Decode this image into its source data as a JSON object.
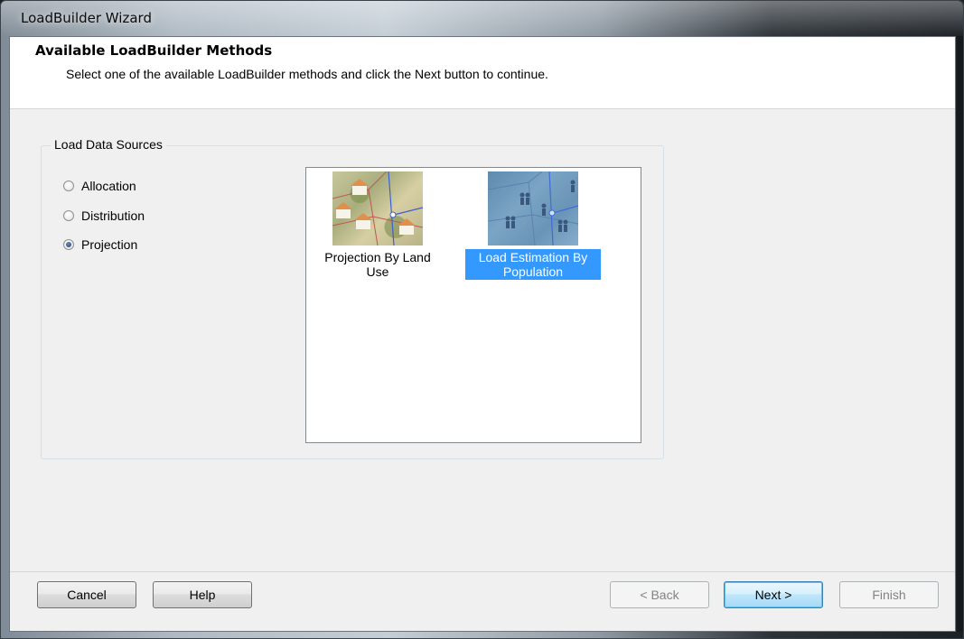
{
  "window": {
    "title": "LoadBuilder Wizard"
  },
  "header": {
    "title": "Available LoadBuilder Methods",
    "subtitle": "Select one of the available LoadBuilder methods and click the Next button to continue."
  },
  "group": {
    "legend": "Load Data Sources",
    "options": [
      {
        "label": "Allocation",
        "checked": false
      },
      {
        "label": "Distribution",
        "checked": false
      },
      {
        "label": "Projection",
        "checked": true
      }
    ]
  },
  "methods": {
    "items": [
      {
        "label": "Projection By Land Use",
        "icon": "land-use-icon",
        "selected": false
      },
      {
        "label": "Load Estimation By Population",
        "icon": "population-icon",
        "selected": true
      }
    ]
  },
  "buttons": {
    "cancel": "Cancel",
    "help": "Help",
    "back": "< Back",
    "next": "Next >",
    "finish": "Finish"
  },
  "colors": {
    "selection": "#3399ff",
    "client_background": "#f0f0f0"
  }
}
